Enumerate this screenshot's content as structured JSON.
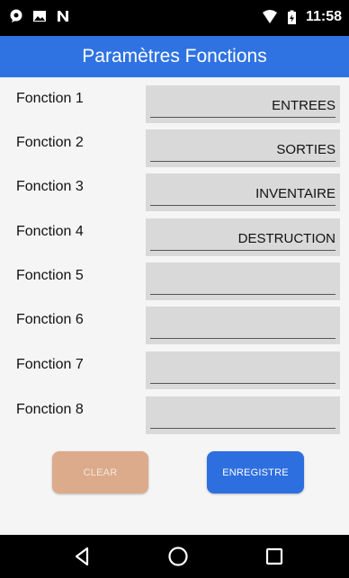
{
  "status_bar": {
    "left_icons": [
      "chat-bubble-icon",
      "image-icon",
      "n-logo-icon"
    ],
    "right_icons": [
      "wifi-icon",
      "battery-charging-icon"
    ],
    "time": "11:58"
  },
  "app_bar": {
    "title": "Paramètres Fonctions"
  },
  "functions": [
    {
      "label": "Fonction 1",
      "value": "ENTREES"
    },
    {
      "label": "Fonction 2",
      "value": "SORTIES"
    },
    {
      "label": "Fonction 3",
      "value": "INVENTAIRE"
    },
    {
      "label": "Fonction 4",
      "value": "DESTRUCTION"
    },
    {
      "label": "Fonction 5",
      "value": ""
    },
    {
      "label": "Fonction 6",
      "value": ""
    },
    {
      "label": "Fonction 7",
      "value": ""
    },
    {
      "label": "Fonction 8",
      "value": ""
    }
  ],
  "buttons": {
    "clear": "CLEAR",
    "save": "ENREGISTRE"
  },
  "nav_bar": {
    "icons": [
      "back-icon",
      "home-icon",
      "recents-icon"
    ]
  },
  "colors": {
    "app_bar": "#2f73e2",
    "clear_button": "#dcab8b",
    "save_button": "#2e6fe0",
    "field_bg": "#d9d9d9"
  }
}
